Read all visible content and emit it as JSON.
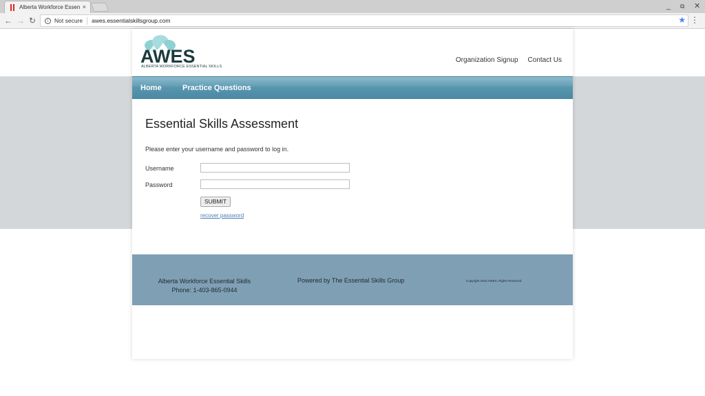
{
  "browser": {
    "tab_title": "Alberta Workforce Essen",
    "tab_close": "×",
    "security_label": "Not secure",
    "url": "awes.essentialskillsgroup.com"
  },
  "site": {
    "logo_text": "AWES",
    "logo_subtitle": "ALBERTA WORKFORCE ESSENTIAL SKILLS",
    "top_links": [
      "Organization Signup",
      "Contact Us"
    ],
    "nav": [
      "Home",
      "Practice Questions"
    ]
  },
  "login": {
    "title": "Essential Skills Assessment",
    "intro": "Please enter your username and password to log in.",
    "username_label": "Username",
    "username_value": "",
    "password_label": "Password",
    "password_value": "",
    "submit_label": "SUBMIT",
    "recover_label": "recover password"
  },
  "footer": {
    "org_name": "Alberta Workforce Essential Skills",
    "phone": "Phone: 1-403-865-0944",
    "powered_by": "Powered by The Essential Skills Group",
    "copyright": "Copyright 2015 AWES, Rights Reserved"
  },
  "colors": {
    "nav_bar": "#5a96b0",
    "footer_bg": "#7f9fb4",
    "gray_band": "#d4d7d9",
    "link": "#4a7fb5",
    "logo_dark": "#1b3a3c"
  }
}
